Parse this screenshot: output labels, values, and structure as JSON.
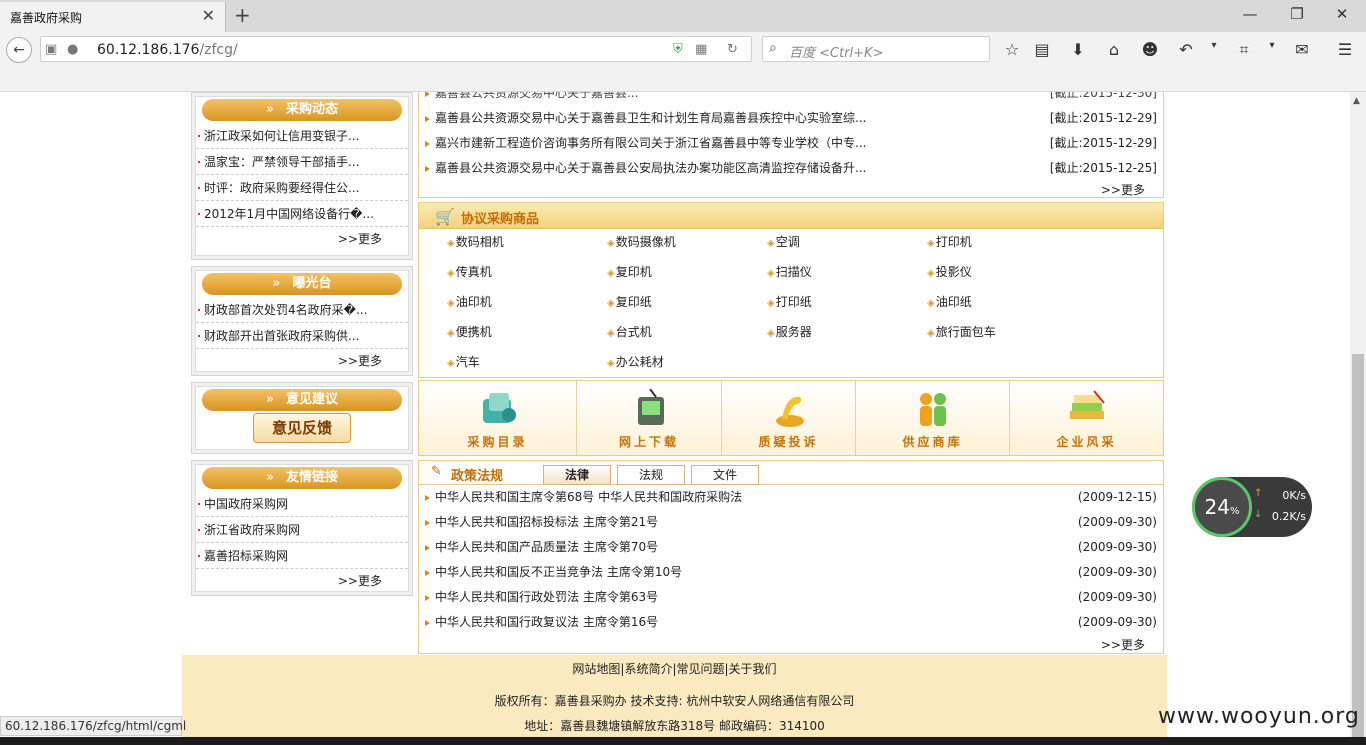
{
  "browser": {
    "tab_title": "嘉善政府采购",
    "url_host": "60.12.186.176",
    "url_path": "/zfcg/",
    "search_placeholder": "百度 <Ctrl+K>",
    "status_url": "60.12.186.176/zfcg/html/cgml"
  },
  "news_top": [
    {
      "title": "嘉善县公共资源交易中心关于嘉善县卫生和计划生育局嘉善县疾控中心实验室综...",
      "date": "[截止:2015-12-29]"
    },
    {
      "title": "嘉兴市建新工程造价咨询事务所有限公司关于浙江省嘉善县中等专业学校（中专...",
      "date": "[截止:2015-12-29]"
    },
    {
      "title": "嘉善县公共资源交易中心关于嘉善县公安局执法办案功能区高清监控存储设备升...",
      "date": "[截止:2015-12-25]"
    }
  ],
  "more_label": ">>更多",
  "sidebar": {
    "procurement_news": {
      "heading": "采购动态",
      "items": [
        "浙江政采如何让信用变银子...",
        "温家宝：严禁领导干部插手...",
        "时评：政府采购要经得住公...",
        "2012年1月中国网络设备行�..."
      ]
    },
    "exposure": {
      "heading": "曝光台",
      "items": [
        "财政部首次处罚4名政府采�...",
        "财政部开出首张政府采购供..."
      ]
    },
    "feedback": {
      "heading": "意见建议",
      "button": "意见反馈"
    },
    "links": {
      "heading": "友情链接",
      "items": [
        "中国政府采购网",
        "浙江省政府采购网",
        "嘉善招标采购网"
      ]
    }
  },
  "products": {
    "heading": "协议采购商品",
    "items": [
      "数码相机",
      "数码摄像机",
      "空调",
      "打印机",
      "传真机",
      "复印机",
      "扫描仪",
      "投影仪",
      "油印机",
      "复印纸",
      "打印纸",
      "油印纸",
      "便携机",
      "台式机",
      "服务器",
      "旅行面包车",
      "汽车",
      "办公耗材"
    ]
  },
  "quicklinks": [
    "采购目录",
    "网上下载",
    "质疑投诉",
    "供应商库",
    "企业风采"
  ],
  "policy": {
    "heading": "政策法规",
    "tabs": [
      "法律",
      "法规",
      "文件"
    ],
    "items": [
      {
        "title": "中华人民共和国主席令第68号 中华人民共和国政府采购法",
        "date": "(2009-12-15)"
      },
      {
        "title": "中华人民共和国招标投标法 主席令第21号",
        "date": "(2009-09-30)"
      },
      {
        "title": "中华人民共和国产品质量法 主席令第70号",
        "date": "(2009-09-30)"
      },
      {
        "title": "中华人民共和国反不正当竞争法 主席令第10号",
        "date": "(2009-09-30)"
      },
      {
        "title": "中华人民共和国行政处罚法 主席令第63号",
        "date": "(2009-09-30)"
      },
      {
        "title": "中华人民共和国行政复议法 主席令第16号",
        "date": "(2009-09-30)"
      }
    ]
  },
  "footer": {
    "links": "网站地图|系统简介|常见问题|关于我们",
    "copyright": "版权所有：嘉善县采购办 技术支持: 杭州中软安人网络通信有限公司",
    "address": "地址：嘉善县魏塘镇解放东路318号 邮政编码：314100"
  },
  "speed_widget": {
    "percent": "24",
    "pct_sign": "%",
    "up": "0K/s",
    "down": "0.2K/s"
  },
  "watermark": "www.wooyun.org",
  "colors": {
    "accent": "#d99421",
    "heading_text": "#c86a00"
  }
}
